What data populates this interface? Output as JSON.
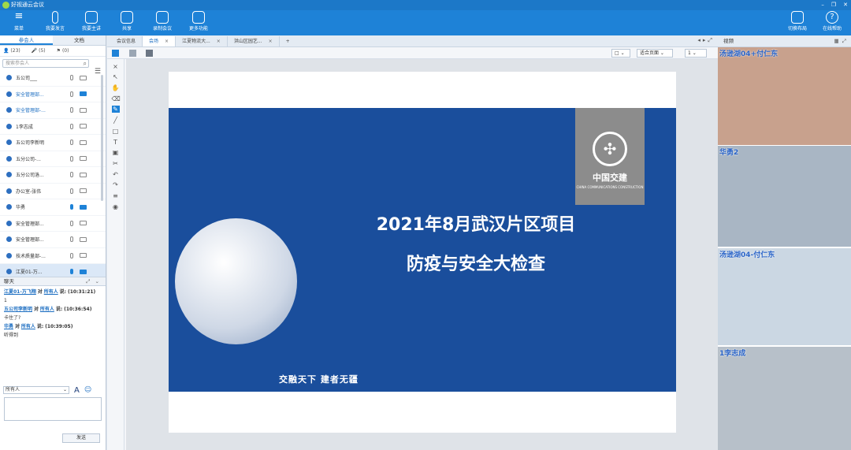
{
  "window": {
    "title": "好视通云会议"
  },
  "toolbar": {
    "menu": "菜单",
    "speak": "我要发言",
    "host": "我要主讲",
    "share": "共享",
    "record": "录制会议",
    "more": "更多功能",
    "layout": "切换布局",
    "help": "在线帮助"
  },
  "left": {
    "tabs": [
      "参会人",
      "文档"
    ],
    "counts": {
      "people": "(23)",
      "hands": "(5)",
      "flags": "(0)"
    },
    "search_placeholder": "搜索参会人",
    "participants": [
      {
        "name": "五公司___",
        "blue": false,
        "mic": false,
        "cam": false
      },
      {
        "name": "安全管理部...",
        "blue": true,
        "mic": false,
        "cam": true
      },
      {
        "name": "安全管理部-...",
        "blue": true,
        "mic": false,
        "cam": false
      },
      {
        "name": "1李志成",
        "blue": false,
        "mic": false,
        "cam": false
      },
      {
        "name": "五公司李新明",
        "blue": false,
        "mic": false,
        "cam": false
      },
      {
        "name": "五分公司-...",
        "blue": false,
        "mic": false,
        "cam": false
      },
      {
        "name": "五分公司洛...",
        "blue": false,
        "mic": false,
        "cam": false
      },
      {
        "name": "办公室-张伟",
        "blue": false,
        "mic": false,
        "cam": false
      },
      {
        "name": "华勇",
        "blue": false,
        "mic": true,
        "cam": true
      },
      {
        "name": "安全管理部...",
        "blue": false,
        "mic": false,
        "cam": false
      },
      {
        "name": "安全管理部...",
        "blue": false,
        "mic": false,
        "cam": false
      },
      {
        "name": "技术质量部-...",
        "blue": false,
        "mic": false,
        "cam": false
      },
      {
        "name": "江夏01-万...",
        "blue": false,
        "mic": true,
        "cam": true
      }
    ],
    "chat_title": "聊天",
    "chat": [
      {
        "from": "江夏01-万飞翔",
        "to": "所有人",
        "time": "(10:31:21)",
        "msg": "1"
      },
      {
        "from": "五公司李新明",
        "to": "所有人",
        "time": "(10:36:54)",
        "msg": "卡住了?"
      },
      {
        "from": "华勇",
        "to": "所有人",
        "time": "(10:39:05)",
        "msg": "听得到"
      }
    ],
    "chat_to_word": "对",
    "chat_say_word": "说:",
    "recipient": "所有人",
    "send": "发送"
  },
  "center": {
    "tabs": [
      {
        "label": "会议信息",
        "close": false
      },
      {
        "label": "会场",
        "close": true
      },
      {
        "label": "江夏物流大...",
        "close": true
      },
      {
        "label": "洪山区园艺...",
        "close": true
      }
    ],
    "zoom": "适合页面",
    "page": "1",
    "slide": {
      "title1": "2021年8月武汉片区项目",
      "title2": "防疫与安全大检查",
      "logo_cn": "中国交建",
      "logo_en": "CHINA COMMUNICATIONS CONSTRUCTION",
      "slogan": "交融天下  建者无疆"
    }
  },
  "right": {
    "title": "视频",
    "videos": [
      {
        "name": "汤逊湖04+付仁东",
        "bg": "#c8a18d"
      },
      {
        "name": "华勇2",
        "bg": "#a9b6c4"
      },
      {
        "name": "汤逊湖04-付仁东",
        "bg": "#cbd7e3"
      },
      {
        "name": "1李志成",
        "bg": "#b7c0c9"
      }
    ]
  }
}
